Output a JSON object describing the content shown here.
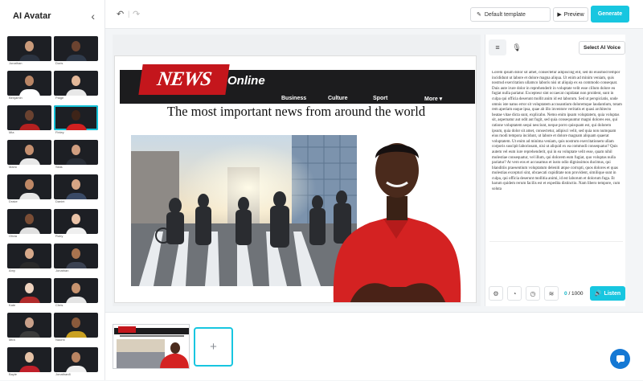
{
  "sidebar": {
    "title": "AI Avatar",
    "avatars": [
      {
        "name": "Jonathan",
        "skin": "#c99a7a",
        "shirt": "#2b3340",
        "selected": false
      },
      {
        "name": "Doris",
        "skin": "#6b4330",
        "shirt": "#2f3a4a",
        "selected": false
      },
      {
        "name": "Benjamin",
        "skin": "#b98565",
        "shirt": "#ffffff",
        "selected": false
      },
      {
        "name": "Paige",
        "skin": "#e3b899",
        "shirt": "#e8e8e8",
        "selected": false
      },
      {
        "name": "Mia",
        "skin": "#6a4230",
        "shirt": "#b32020",
        "selected": false
      },
      {
        "name": "Finley",
        "skin": "#3e2418",
        "shirt": "#d22020",
        "selected": true
      },
      {
        "name": "Mario",
        "skin": "#c48f6f",
        "shirt": "#e8e8e8",
        "selected": false
      },
      {
        "name": "Silas",
        "skin": "#d09e80",
        "shirt": "#2a2f38",
        "selected": false
      },
      {
        "name": "Drake",
        "skin": "#bf8866",
        "shirt": "#e6e6e6",
        "selected": false
      },
      {
        "name": "Daniel",
        "skin": "#d6a585",
        "shirt": "#3a4a66",
        "selected": false
      },
      {
        "name": "Olivia",
        "skin": "#7a4d35",
        "shirt": "#e0e0e0",
        "selected": false
      },
      {
        "name": "Ruby",
        "skin": "#eac3a8",
        "shirt": "#efefef",
        "selected": false
      },
      {
        "name": "Amy",
        "skin": "#d7a98a",
        "shirt": "#2a2a2a",
        "selected": false
      },
      {
        "name": "Jonathan",
        "skin": "#a8734f",
        "shirt": "#3b4252",
        "selected": false
      },
      {
        "name": "Kate",
        "skin": "#efd3bf",
        "shirt": "#b02a2a",
        "selected": false
      },
      {
        "name": "Chris",
        "skin": "#c7936f",
        "shirt": "#e4e4e4",
        "selected": false
      },
      {
        "name": "Mira",
        "skin": "#c9a08a",
        "shirt": "#3b3b3b",
        "selected": false
      },
      {
        "name": "Naomi",
        "skin": "#8a5a3c",
        "shirt": "#c9a020",
        "selected": false
      },
      {
        "name": "Bayle",
        "skin": "#e6c2a6",
        "shirt": "#c0202a",
        "selected": false
      },
      {
        "name": "Jonathan8",
        "skin": "#b98462",
        "shirt": "#f0f0f0",
        "selected": false
      }
    ]
  },
  "toolbar": {
    "undo_icon": "undo-icon",
    "redo_icon": "redo-icon",
    "template_label": "Default template",
    "preview_label": "Preview",
    "generate_label": "Generate"
  },
  "slide": {
    "logo_news": "NEWS",
    "logo_online": "Online",
    "menu": [
      "Business",
      "Culture",
      "Sport",
      "More"
    ],
    "headline": "The most important news from around the world"
  },
  "right_panel": {
    "voice_button": "Select AI Voice",
    "script": "Lorem ipsum dolor sit amet, consectetur adipiscing elit, sed do eiusmod tempor incididunt ut labore et dolore magna aliqua. Ut enim ad minim veniam, quis nostrud exercitation ullamco laboris nisi ut aliquip ex ea commodo consequat. Duis aute irure dolor in reprehenderit in voluptate velit esse cillum dolore eu fugiat nulla pariatur. Excepteur sint occaecat cupidatat non proident, sunt in culpa qui officia deserunt mollit anim id est laborum. Sed ut perspiciatis, unde omnis iste natus error sit voluptatem accusantium doloremque laudantium, totam rem aperiam eaque ipsa, quae ab illo inventore veritatis et quasi architecto beatae vitae dicta sunt, explicabo. Nemo enim ipsam voluptatem, quia voluptas sit, aspernatur aut odit aut fugit, sed quia consequuntur magni dolores eos, qui ratione voluptatem sequi nesciunt, neque porro quisquam est, qui dolorem ipsum, quia dolor sit amet, consectetur, adipisci velit, sed quia non numquam eius modi tempora incidunt, ut labore et dolore magnam aliquam quaerat voluptatem. Ut enim ad minima veniam, quis nostrum exercitationem ullam corporis suscipit laboriosam, nisi ut aliquid ex ea commodi consequatur? Quis autem vel eum iure reprehenderit, qui in ea voluptate velit esse, quam nihil molestiae consequatur, vel illum, qui dolorem eum fugiat, quo voluptas nulla pariatur? At vero eos et accusamus et iusto odio dignissimos ducimus, qui blanditiis praesentium voluptatum deleniti atque corrupti, quos dolores et quas molestias excepturi sint, obcaecati cupiditate non provident, similique sunt in culpa, qui officia deserunt mollitia animi, id est laborum et dolorum fuga. Et harum quidem rerum facilis est et expedita distinctio. Nam libero tempore, cum soluta",
    "char_count": "0",
    "char_limit": "/ 1000",
    "listen_label": "Listen"
  },
  "colors": {
    "accent": "#17c6e0",
    "news_red": "#c4161c",
    "shirt_red": "#d42222"
  }
}
